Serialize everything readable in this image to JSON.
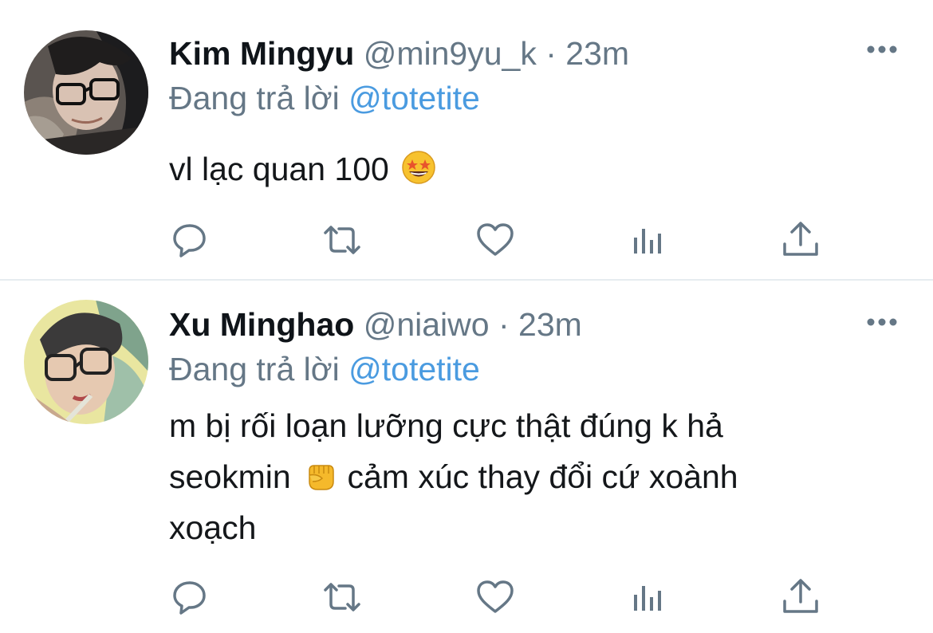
{
  "tweets": [
    {
      "name": "Kim Mingyu",
      "handle": "@min9yu_k",
      "separator": "·",
      "time": "23m",
      "reply_prefix": "Đang trả lời",
      "reply_to": "@totetite",
      "text_lines": [
        "vl lạc quan 100"
      ],
      "emoji": "star-struck-emoji"
    },
    {
      "name": "Xu Minghao",
      "handle": "@niaiwo",
      "separator": "·",
      "time": "23m",
      "reply_prefix": "Đang trả lời",
      "reply_to": "@totetite",
      "text_line1": "m bị rối loạn lưỡng cực thật đúng k hả",
      "text_line2a": "seokmin",
      "text_line2b": "cảm xúc thay đổi cứ xoành",
      "text_line3": "xoạch",
      "emoji": "fist-emoji"
    }
  ],
  "actions": [
    "reply-icon",
    "retweet-icon",
    "like-icon",
    "analytics-icon",
    "share-icon"
  ],
  "colors": {
    "link": "#4a9be0",
    "meta": "#657786",
    "icon": "#657786",
    "divider": "#e6ecf0"
  }
}
